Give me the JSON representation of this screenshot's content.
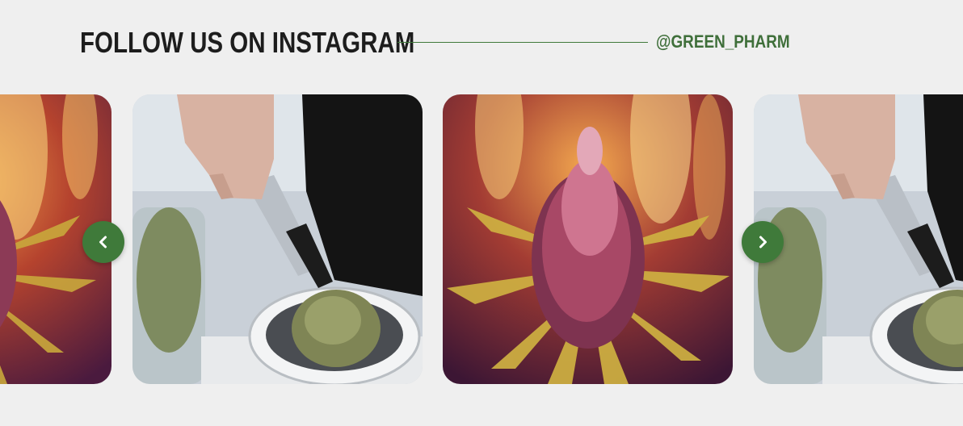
{
  "section": {
    "title": "FOLLOW US ON INSTAGRAM",
    "handle": "@GREEN_PHARM"
  },
  "carousel": {
    "posts": [
      {
        "subject": "cannabis-flower-bud"
      },
      {
        "subject": "tongs-weighing-bud-on-scale"
      },
      {
        "subject": "cannabis-flower-bud"
      },
      {
        "subject": "tongs-weighing-bud-on-scale"
      }
    ],
    "prev_icon": "chevron-left-icon",
    "next_icon": "chevron-right-icon"
  },
  "colors": {
    "background": "#efefef",
    "accent": "#3f7a3a",
    "title": "#1d1d1d"
  }
}
